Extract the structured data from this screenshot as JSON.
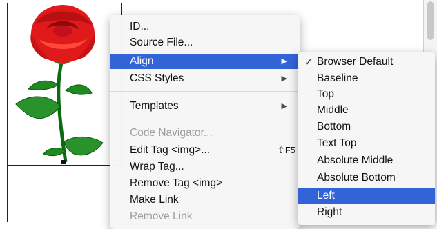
{
  "context_menu": {
    "items": [
      {
        "label": "ID...",
        "enabled": true
      },
      {
        "label": "Source File...",
        "enabled": true
      },
      {
        "label": "Align",
        "enabled": true,
        "highlighted": true,
        "submenu": true
      },
      {
        "label": "CSS Styles",
        "enabled": true,
        "submenu": true
      },
      {
        "label": "Templates",
        "enabled": true,
        "submenu": true
      },
      {
        "label": "Code Navigator...",
        "enabled": false
      },
      {
        "label": "Edit Tag <img>...",
        "enabled": true,
        "shortcut": "⇧F5"
      },
      {
        "label": "Wrap Tag...",
        "enabled": true
      },
      {
        "label": "Remove Tag <img>",
        "enabled": true
      },
      {
        "label": "Make Link",
        "enabled": true
      },
      {
        "label": "Remove Link",
        "enabled": false
      }
    ],
    "submenu_arrow_glyph": "▶"
  },
  "align_submenu": {
    "checkmark_glyph": "✓",
    "items": [
      {
        "label": "Browser Default",
        "checked": true
      },
      {
        "label": "Baseline"
      },
      {
        "label": "Top"
      },
      {
        "label": "Middle"
      },
      {
        "label": "Bottom"
      },
      {
        "label": "Text Top"
      },
      {
        "label": "Absolute Middle"
      },
      {
        "label": "Absolute Bottom"
      },
      {
        "label": "Left",
        "highlighted": true
      },
      {
        "label": "Right"
      }
    ]
  },
  "document": {
    "image_icon": "rose-image"
  },
  "colors": {
    "highlight": "#3264d8",
    "rose_red": "#e0191b",
    "stem_green": "#0a6b12"
  }
}
